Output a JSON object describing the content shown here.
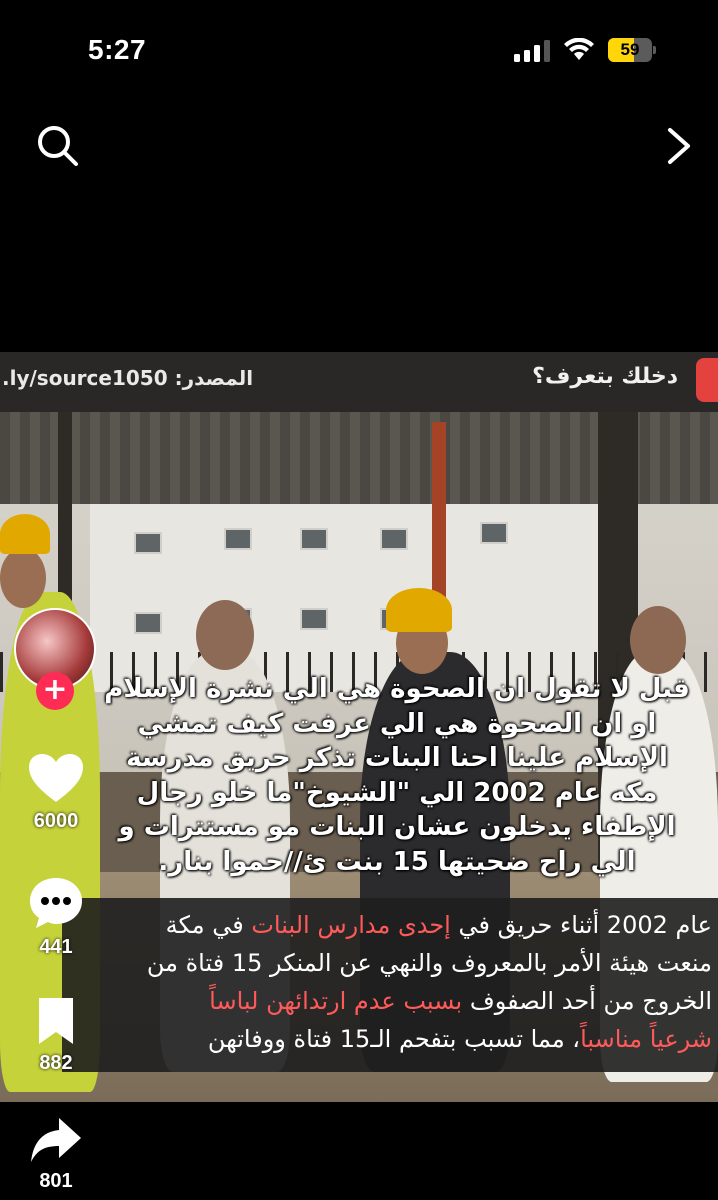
{
  "status_bar": {
    "time": "5:27",
    "battery": "59",
    "battery_level_percent": 59,
    "battery_color": "#ffd60a"
  },
  "video": {
    "source_label": ".ly/source1050 :المصدر",
    "channel_tag": "دخلك بتعرف؟",
    "overlay_lines": [
      "قبل لا تقول ان الصحوة هي الي نشرة الإسلام",
      "او ان الصحوة هي الي عرفت كيف تمشي",
      "الإسلام علينا احنا البنات تذكر حريق مدرسة",
      "مكه عام 2002 الي \"الشيوخ\"ما خلو رجال",
      "الإطفاء يدخلون عشان البنات مو مستترات و",
      "الي راح ضحيتها 15 بنت ئ//حموا بنار."
    ],
    "caption": {
      "line1_a": "عام 2002 أثناء حريق في ",
      "line1_hl": "إحدى مدارس البنات",
      "line1_b": " في مكة",
      "line2": "منعت هيئة الأمر بالمعروف والنهي عن المنكر 15 فتاة من",
      "line3_a": "الخروج من أحد الصفوف ",
      "line3_hl": "بسبب عدم ارتدائهن لباساً",
      "line4_hl": "شرعياً مناسباً",
      "line4_b": "، مما تسبب بتفحم الـ15 فتاة ووفاتهن",
      "highlight_color": "#ff5a5a"
    }
  },
  "actions": {
    "follow": "+",
    "likes": "6000",
    "comments": "441",
    "saves": "882",
    "shares": "801"
  }
}
